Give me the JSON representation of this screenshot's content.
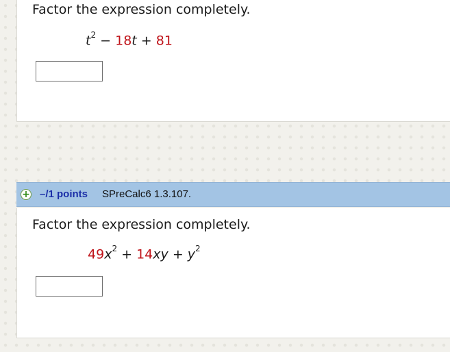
{
  "problem1": {
    "prompt": "Factor the expression completely.",
    "expression": {
      "term1_var": "t",
      "term1_exp": "2",
      "op1": "−",
      "term2_coef": "18",
      "term2_var": "t",
      "op2": "+",
      "term3": "81"
    }
  },
  "problem2": {
    "header": {
      "points": "–/1 points",
      "source": "SPreCalc6 1.3.107."
    },
    "prompt": "Factor the expression completely.",
    "expression": {
      "term1_coef": "49",
      "term1_var": "x",
      "term1_exp": "2",
      "op1": "+",
      "term2_coef": "14",
      "term2_var": "xy",
      "op2": "+",
      "term3_var": "y",
      "term3_exp": "2"
    }
  },
  "icons": {
    "expand": "plus-circle-icon"
  },
  "colors": {
    "header_bar": "#a3c4e4",
    "points_text": "#1b2fa8",
    "coefficient_red": "#c0151b"
  }
}
